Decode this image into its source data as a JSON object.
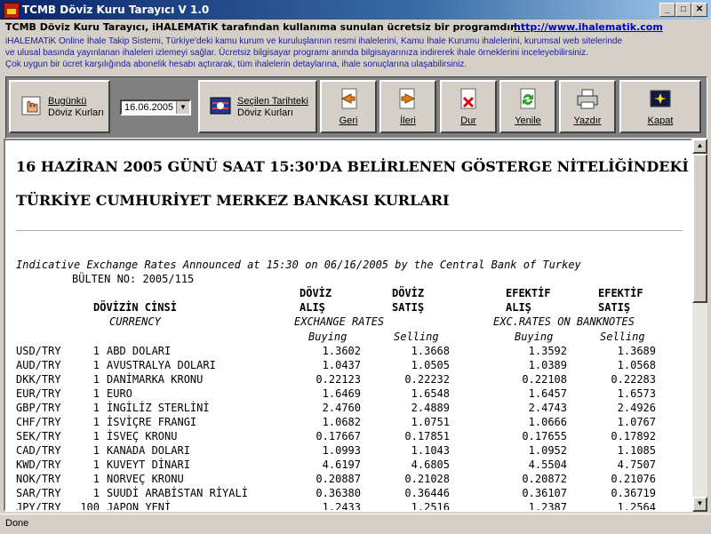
{
  "window": {
    "title": "TCMB Döviz Kuru Tarayıcı V 1.0"
  },
  "header": {
    "headline": "TCMB Döviz Kuru Tarayıcı, iHALEMATiK tarafından kullanıma sunulan ücretsiz bir programdır.",
    "link": "http://www.ihalematik.com",
    "lines": [
      "iHALEMATiK Online İhale Takip Sistemi, Türkiye'deki kamu kurum ve kuruluşlarının resmi ihalelerini, Kamu İhale Kurumu ihalelerini, kurumsal web sitelerinde",
      "ve ulusal basında yayınlanan ihaleleri izlemeyi sağlar. Ücretsiz bilgisayar programı anında bilgisayarınıza indirerek ihale örneklerini inceleyebilirsiniz.",
      "Çok uygun bir ücret karşılığında abonelik hesabı açtırarak, tüm ihalelerin detaylarına, ihale sonuçlarına ulaşabilirsiniz."
    ]
  },
  "toolbar": {
    "today_line1": "Bugünkü",
    "today_line2": "Döviz Kurları",
    "date_value": "16.06.2005",
    "selected_line1": "Seçilen Tarihteki",
    "selected_line2": "Döviz Kurları",
    "back": "Geri",
    "forward": "İleri",
    "stop": "Dur",
    "refresh": "Yenile",
    "print": "Yazdır",
    "close": "Kapat"
  },
  "document": {
    "title_line1": "16 HAZİRAN 2005 GÜNÜ SAAT 15:30'DA BELİRLENEN GÖSTERGE NİTELİĞİNDEKİ",
    "title_line2": "TÜRKİYE CUMHURİYET MERKEZ BANKASI KURLARI",
    "indicative": "Indicative Exchange Rates Announced at 15:30 on 06/16/2005 by the Central Bank of Turkey",
    "bulletin": "BÜLTEN NO: 2005/115",
    "col_doviz": "DÖVİZ",
    "col_efektif": "EFEKTİF",
    "col_alis": "ALIŞ",
    "col_satis": "SATIŞ",
    "col_cins": "DÖVİZİN CİNSİ",
    "currency": "CURRENCY",
    "exchange_rates": "EXCHANGE RATES",
    "exc_banknotes": "EXC.RATES ON BANKNOTES",
    "buying": "Buying",
    "selling": "Selling",
    "rows": [
      {
        "code": "USD/TRY",
        "unit": "1",
        "name": "ABD DOLARI",
        "fb": "1.3602",
        "fs": "1.3668",
        "eb": "1.3592",
        "es": "1.3689"
      },
      {
        "code": "AUD/TRY",
        "unit": "1",
        "name": "AVUSTRALYA DOLARI",
        "fb": "1.0437",
        "fs": "1.0505",
        "eb": "1.0389",
        "es": "1.0568"
      },
      {
        "code": "DKK/TRY",
        "unit": "1",
        "name": "DANİMARKA KRONU",
        "fb": "0.22123",
        "fs": "0.22232",
        "eb": "0.22108",
        "es": "0.22283"
      },
      {
        "code": "EUR/TRY",
        "unit": "1",
        "name": "EURO",
        "fb": "1.6469",
        "fs": "1.6548",
        "eb": "1.6457",
        "es": "1.6573"
      },
      {
        "code": "GBP/TRY",
        "unit": "1",
        "name": "İNGİLİZ STERLİNİ",
        "fb": "2.4760",
        "fs": "2.4889",
        "eb": "2.4743",
        "es": "2.4926"
      },
      {
        "code": "CHF/TRY",
        "unit": "1",
        "name": "İSVİÇRE FRANGI",
        "fb": "1.0682",
        "fs": "1.0751",
        "eb": "1.0666",
        "es": "1.0767"
      },
      {
        "code": "SEK/TRY",
        "unit": "1",
        "name": "İSVEÇ KRONU",
        "fb": "0.17667",
        "fs": "0.17851",
        "eb": "0.17655",
        "es": "0.17892"
      },
      {
        "code": "CAD/TRY",
        "unit": "1",
        "name": "KANADA DOLARI",
        "fb": "1.0993",
        "fs": "1.1043",
        "eb": "1.0952",
        "es": "1.1085"
      },
      {
        "code": "KWD/TRY",
        "unit": "1",
        "name": "KUVEYT DİNARI",
        "fb": "4.6197",
        "fs": "4.6805",
        "eb": "4.5504",
        "es": "4.7507"
      },
      {
        "code": "NOK/TRY",
        "unit": "1",
        "name": "NORVEÇ KRONU",
        "fb": "0.20887",
        "fs": "0.21028",
        "eb": "0.20872",
        "es": "0.21076"
      },
      {
        "code": "SAR/TRY",
        "unit": "1",
        "name": "SUUDİ ARABİSTAN RİYALİ",
        "fb": "0.36380",
        "fs": "0.36446",
        "eb": "0.36107",
        "es": "0.36719"
      },
      {
        "code": "JPY/TRY",
        "unit": "100",
        "name": "JAPON YENİ",
        "fb": "1.2433",
        "fs": "1.2516",
        "eb": "1.2387",
        "es": "1.2564"
      }
    ]
  },
  "status": {
    "text": "Done"
  }
}
